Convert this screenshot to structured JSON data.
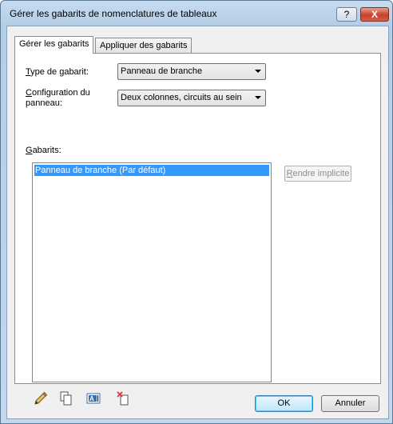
{
  "window": {
    "title": "Gérer les gabarits de nomenclatures de tableaux",
    "help_label": "?",
    "close_label": "X"
  },
  "tabs": [
    {
      "label": "Gérer les gabarits"
    },
    {
      "label": "Appliquer des gabarits"
    }
  ],
  "form": {
    "type_label_hotkey": "T",
    "type_label_rest": "ype de gabarit:",
    "type_value": "Panneau de branche",
    "config_label_hotkey": "C",
    "config_label_rest": "onfiguration du",
    "config_label_line2": "panneau:",
    "config_value": "Deux colonnes, circuits au sein",
    "templates_label_hotkey": "G",
    "templates_label_rest": "abarits:"
  },
  "templates": {
    "items": [
      "Panneau de branche (Par défaut)"
    ],
    "selected_index": 0
  },
  "actions": {
    "make_default_hotkey": "R",
    "make_default_rest": "endre implicite",
    "make_default_enabled": false,
    "toolbar_icons": [
      "pencil-edit-icon",
      "duplicate-icon",
      "rename-icon",
      "delete-icon"
    ]
  },
  "dialog_buttons": {
    "ok": "OK",
    "cancel": "Annuler"
  }
}
